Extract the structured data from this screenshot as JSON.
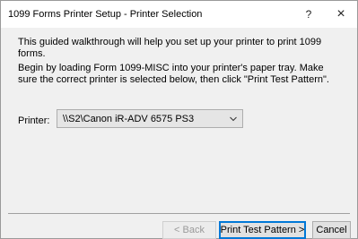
{
  "window": {
    "title": "1099 Forms Printer Setup - Printer Selection",
    "help_glyph": "?",
    "close_glyph": "×"
  },
  "content": {
    "intro": "This guided walkthrough will help you set up your printer to print 1099 forms.",
    "instructions": "Begin by loading Form 1099-MISC into your printer's paper tray. Make sure the correct printer is selected below, then click \"Print Test Pattern\".",
    "printer_label": "Printer:",
    "printer_selected": "\\\\S2\\Canon iR-ADV 6575 PS3"
  },
  "buttons": {
    "back": "< Back",
    "print_test": "Print Test Pattern >",
    "cancel": "Cancel"
  },
  "icons": {
    "help": "help-icon",
    "close": "close-icon",
    "dropdown": "chevron-down-icon"
  }
}
